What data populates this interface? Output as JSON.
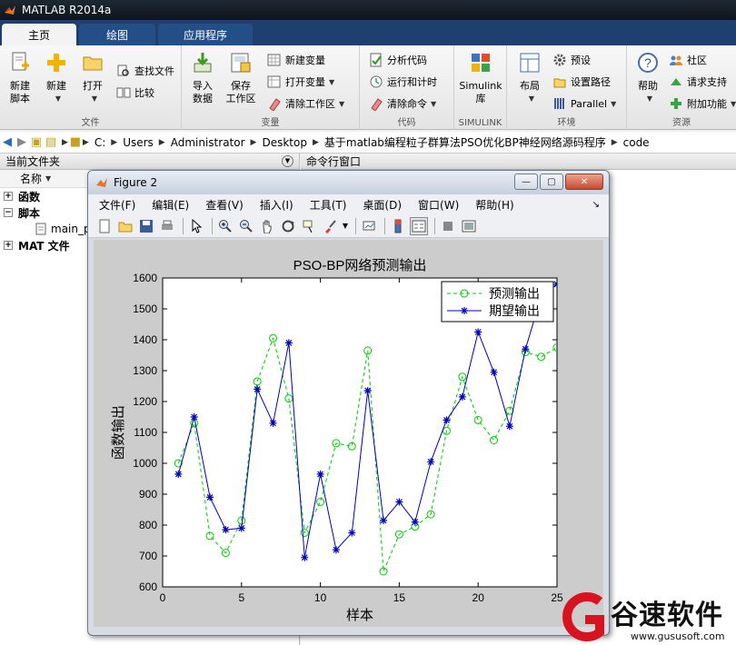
{
  "app": {
    "title": "MATLAB R2014a"
  },
  "tabs": [
    {
      "label": "主页",
      "active": true
    },
    {
      "label": "绘图",
      "active": false
    },
    {
      "label": "应用程序",
      "active": false
    }
  ],
  "ribbon": {
    "file": {
      "label": "文件",
      "new_script": "新建\n脚本",
      "new": "新建",
      "open": "打开",
      "find_files": "查找文件",
      "compare": "比较"
    },
    "variable": {
      "label": "变量",
      "import": "导入\n数据",
      "save_workspace": "保存\n工作区",
      "new_variable": "新建变量",
      "open_variable": "打开变量",
      "clear_workspace": "清除工作区"
    },
    "code": {
      "label": "代码",
      "analyze": "分析代码",
      "run_time": "运行和计时",
      "clear_commands": "清除命令"
    },
    "simulink": {
      "label": "SIMULINK",
      "library": "Simulink\n库"
    },
    "environment": {
      "label": "环境",
      "layout": "布局",
      "preferences": "预设",
      "set_path": "设置路径",
      "parallel": "Parallel"
    },
    "resources": {
      "label": "资源",
      "help": "帮助",
      "community": "社区",
      "request_support": "请求支持",
      "addons": "附加功能"
    }
  },
  "address": {
    "crumbs": [
      "C:",
      "Users",
      "Administrator",
      "Desktop",
      "基于matlab编程粒子群算法PSO优化BP神经网络源码程序",
      "code"
    ]
  },
  "current_folder": {
    "title": "当前文件夹",
    "column_name": "名称",
    "items": [
      {
        "label": "函数",
        "type": "group"
      },
      {
        "label": "脚本",
        "type": "group"
      },
      {
        "label": "main_p",
        "type": "file"
      },
      {
        "label": "MAT 文件",
        "type": "group"
      }
    ]
  },
  "command_window": {
    "title": "命令行窗口"
  },
  "figure": {
    "title": "Figure 2",
    "menu": [
      "文件(F)",
      "编辑(E)",
      "查看(V)",
      "插入(I)",
      "工具(T)",
      "桌面(D)",
      "窗口(W)",
      "帮助(H)"
    ]
  },
  "chart_data": {
    "type": "line",
    "title": "PSO-BP网络预测输出",
    "xlabel": "样本",
    "ylabel": "函数输出",
    "xlim": [
      0,
      25
    ],
    "ylim": [
      600,
      1600
    ],
    "xticks": [
      0,
      5,
      10,
      15,
      20,
      25
    ],
    "yticks": [
      600,
      700,
      800,
      900,
      1000,
      1100,
      1200,
      1300,
      1400,
      1500,
      1600
    ],
    "grid": false,
    "legend_position": "top-right",
    "x": [
      1,
      2,
      3,
      4,
      5,
      6,
      7,
      8,
      9,
      10,
      11,
      12,
      13,
      14,
      15,
      16,
      17,
      18,
      19,
      20,
      21,
      22,
      23,
      24,
      25
    ],
    "series": [
      {
        "name": "预测输出",
        "color": "#00cc00",
        "style": "dashed",
        "marker": "circle",
        "values": [
          1000,
          1130,
          765,
          710,
          815,
          1265,
          1405,
          1210,
          775,
          875,
          1065,
          1055,
          1365,
          650,
          770,
          795,
          835,
          1105,
          1280,
          1140,
          1075,
          1170,
          1360,
          1345,
          1375
        ]
      },
      {
        "name": "期望输出",
        "color": "#0000bb",
        "style": "solid",
        "marker": "star",
        "values": [
          965,
          1150,
          890,
          785,
          790,
          1240,
          1130,
          1390,
          695,
          965,
          720,
          775,
          1235,
          815,
          875,
          810,
          1005,
          1140,
          1215,
          1425,
          1295,
          1120,
          1370,
          1540,
          1580
        ]
      }
    ]
  },
  "watermark": {
    "text": "谷速软件",
    "url": "www.gususoft.com",
    "brand_color": "#d8131f"
  }
}
